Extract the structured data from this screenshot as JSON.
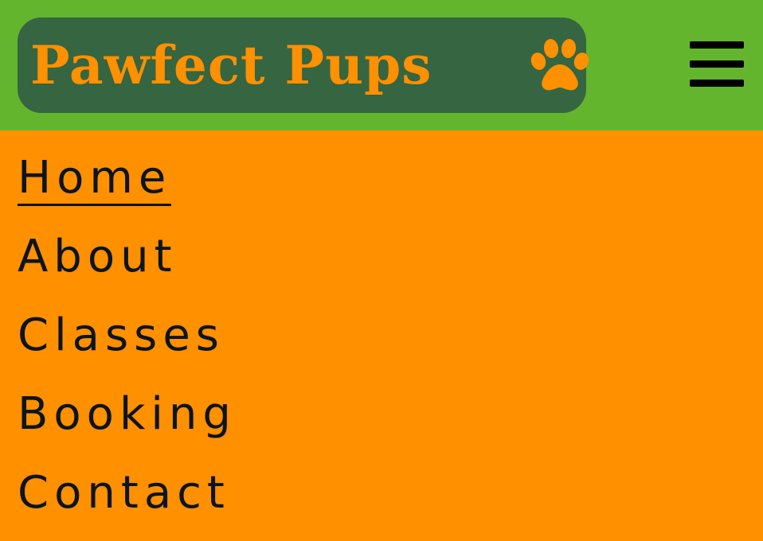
{
  "header": {
    "brand": "Pawfect Pups",
    "logo_icon": "paw-icon",
    "menu_icon": "hamburger-menu-icon"
  },
  "nav": {
    "items": [
      {
        "label": "Home",
        "active": true
      },
      {
        "label": "About",
        "active": false
      },
      {
        "label": "Classes",
        "active": false
      },
      {
        "label": "Booking",
        "active": false
      },
      {
        "label": "Contact",
        "active": false
      }
    ]
  },
  "colors": {
    "header_bg": "#63b52e",
    "logo_bg": "#366542",
    "accent": "#ff9000",
    "text": "#0c1420"
  }
}
